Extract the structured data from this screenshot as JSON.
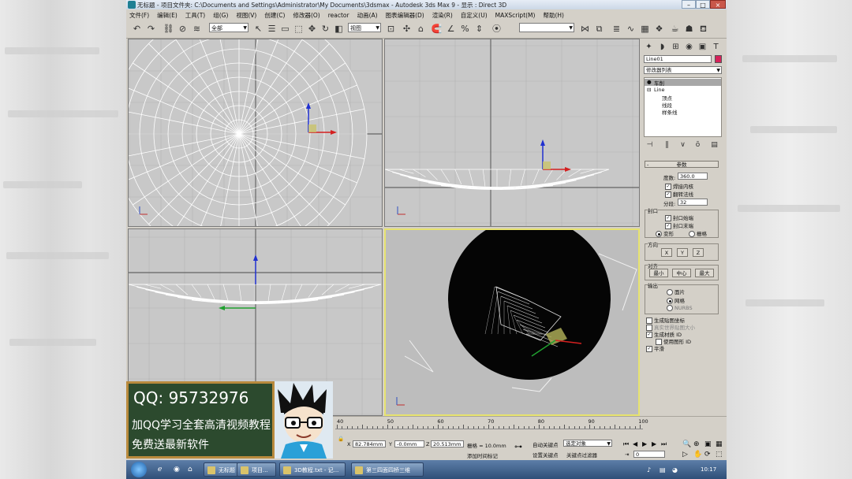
{
  "window": {
    "title": "无标题 - 项目文件夹: C:\\Documents and Settings\\Administrator\\My Documents\\3dsmax    - Autodesk 3ds Max 9    - 显示 : Direct 3D",
    "minimize": "–",
    "maximize": "□",
    "close": "×"
  },
  "menu": [
    "文件(F)",
    "编辑(E)",
    "工具(T)",
    "组(G)",
    "视图(V)",
    "创建(C)",
    "修改器(O)",
    "reactor",
    "动画(A)",
    "图表编辑器(D)",
    "渲染(R)",
    "自定义(U)",
    "MAXScript(M)",
    "帮助(H)"
  ],
  "toolbar": {
    "selection_filter": "全部",
    "reference_coord": "视图",
    "named_selection": ""
  },
  "viewports": {
    "top": "",
    "front": "",
    "left": "",
    "perspective": ""
  },
  "command_panel": {
    "object_name": "Line01",
    "object_color": "#d6225a",
    "modifier_list": "修改器列表",
    "stack": {
      "lathe": "车削",
      "line": "Line",
      "sub_vertex": "顶点",
      "sub_segment": "线段",
      "sub_spline": "样条线"
    },
    "rollout_title": "参数",
    "degrees_label": "度数:",
    "degrees_value": "360.0",
    "weld_core": "焊接内核",
    "flip_normals": "翻转法线",
    "segments_label": "分段:",
    "segments_value": "32",
    "capping_title": "封口",
    "cap_start": "封口始端",
    "cap_end": "封口末端",
    "morph": "变形",
    "grid": "栅格",
    "direction_title": "方向",
    "dir_x": "X",
    "dir_y": "Y",
    "dir_z": "Z",
    "align_title": "对齐",
    "align_min": "最小",
    "align_center": "中心",
    "align_max": "最大",
    "output_title": "输出",
    "out_patch": "面片",
    "out_mesh": "网格",
    "out_nurbs": "NURBS",
    "gen_mapping": "生成贴图坐标",
    "real_world": "真实世界贴图大小",
    "gen_material_ids": "生成材质 ID",
    "use_shape_ids": "使用图形 ID",
    "smooth": "平滑"
  },
  "timeline": {
    "ticks": [
      "40",
      "50",
      "60",
      "70",
      "80",
      "90",
      "100"
    ]
  },
  "status": {
    "x_label": "X",
    "x_value": "82.784mm",
    "y_label": "Y",
    "y_value": "-0.0mm",
    "z_label": "Z",
    "z_value": "20.513mm",
    "grid_label": "栅格 = 10.0mm",
    "add_time_tag": "添加时间标记",
    "auto_key": "自动关键点",
    "set_key": "设置关键点",
    "selected_label": "选定对象",
    "key_filters": "关键点过滤器",
    "frame_value": "0"
  },
  "overlay": {
    "line1": "QQ: 95732976",
    "line2": "加QQ学习全套高清视频教程",
    "line3": "免费送最新软件"
  },
  "taskbar": {
    "tasks": [
      "无标题",
      "项目...",
      "3D教程.txt - 记...",
      "第三四面四桥三维"
    ],
    "clock": "10:17"
  }
}
